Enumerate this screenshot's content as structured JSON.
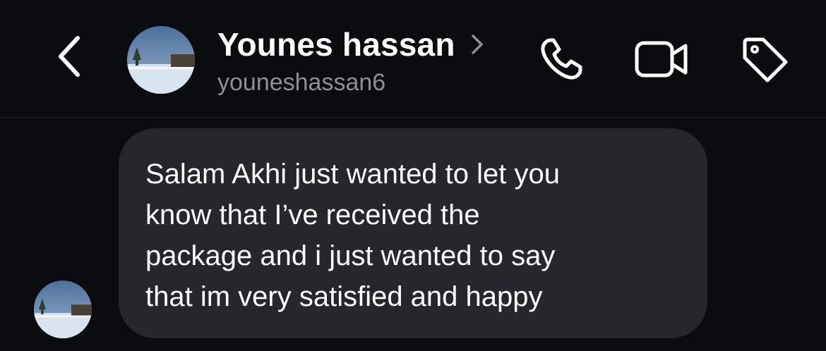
{
  "header": {
    "display_name": "Younes hassan",
    "username": "youneshassan6",
    "back_icon": "chevron-left-icon",
    "profile_chevron_icon": "chevron-right-icon",
    "actions": [
      {
        "icon": "phone-icon"
      },
      {
        "icon": "video-camera-icon"
      },
      {
        "icon": "tag-icon"
      }
    ]
  },
  "thread": {
    "messages": [
      {
        "sender": "youneshassan6",
        "text": "Salam Akhi just wanted to let you\nknow that I’ve received the\npackage and i just wanted to say\nthat im very satisfied and happy"
      }
    ]
  },
  "colors": {
    "background": "#0b0c10",
    "bubble": "#26272c",
    "text": "#ffffff",
    "secondary_text": "#8d9096",
    "divider": "#24262b"
  }
}
